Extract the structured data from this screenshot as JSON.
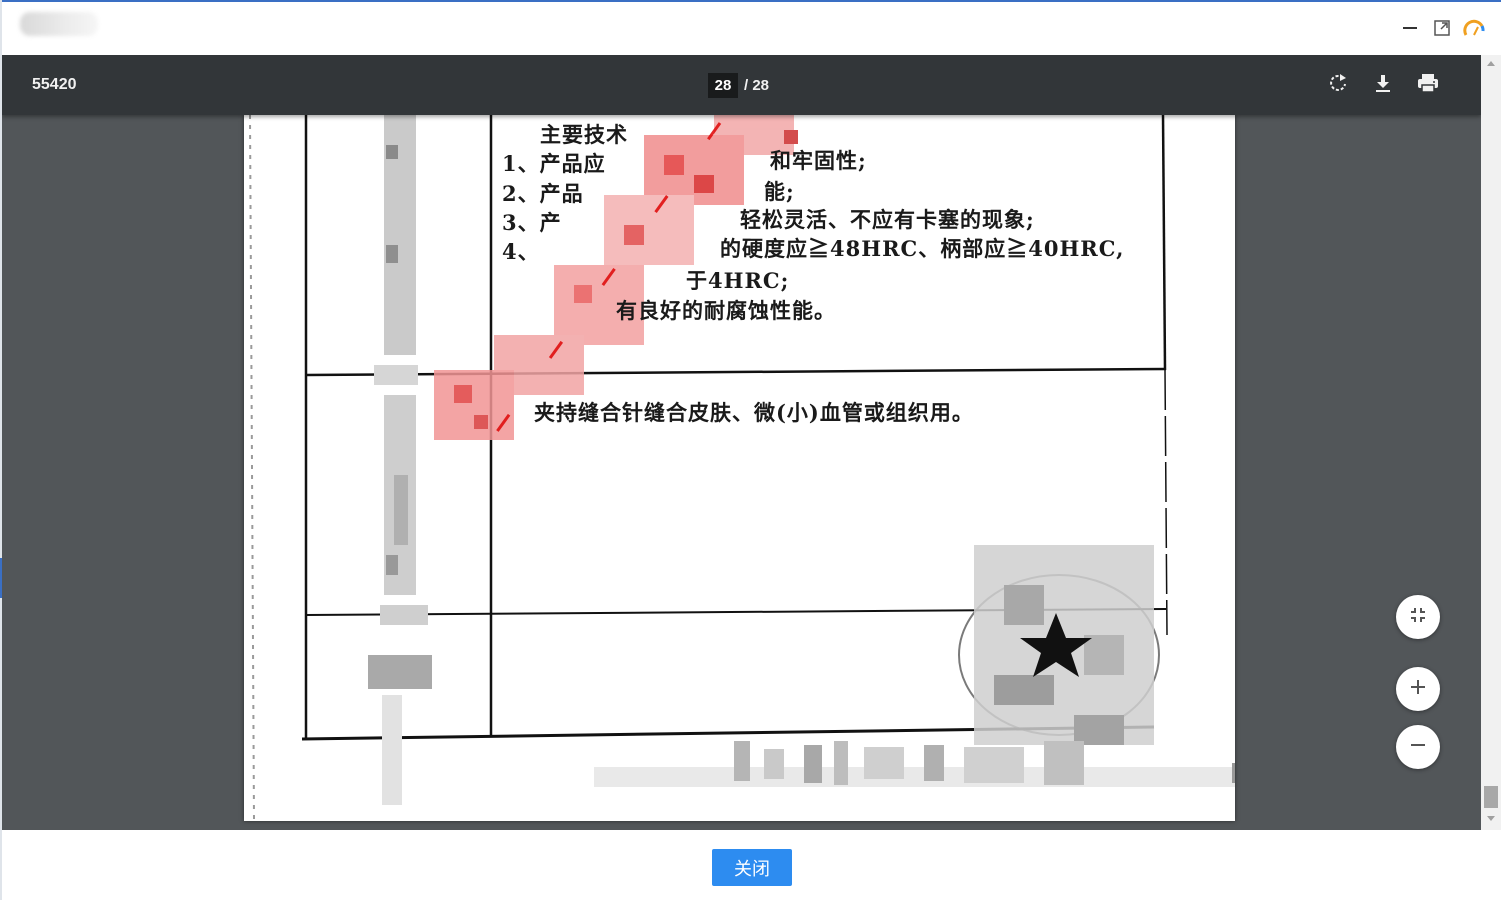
{
  "window": {
    "controls": [
      "minimize-icon",
      "maximize-icon",
      "gauge-icon"
    ]
  },
  "viewer": {
    "doc_title": "55420",
    "current_page": "28",
    "page_separator": "/ 28",
    "toolbar_icons": [
      "rotate-icon",
      "download-icon",
      "print-icon"
    ],
    "zoom_icons": [
      "fit-page-icon",
      "zoom-in-icon",
      "zoom-out-icon"
    ]
  },
  "document": {
    "lines": [
      "主要技术",
      "1、产品应",
      "和牢固性;",
      "2、产品",
      "能;",
      "3、产",
      "轻松灵活、不应有卡塞的现象;",
      "4、",
      "的硬度应≧48HRC、柄部应≧40HRC,",
      "于4HRC;",
      "有良好的耐腐蚀性能。",
      "夹持缝合针缝合皮肤、微(小)血管或组织用。"
    ]
  },
  "footer": {
    "close_label": "关闭"
  },
  "colors": {
    "accent": "#2d8cf0",
    "toolbar": "#323639",
    "viewer_bg": "#525659"
  }
}
